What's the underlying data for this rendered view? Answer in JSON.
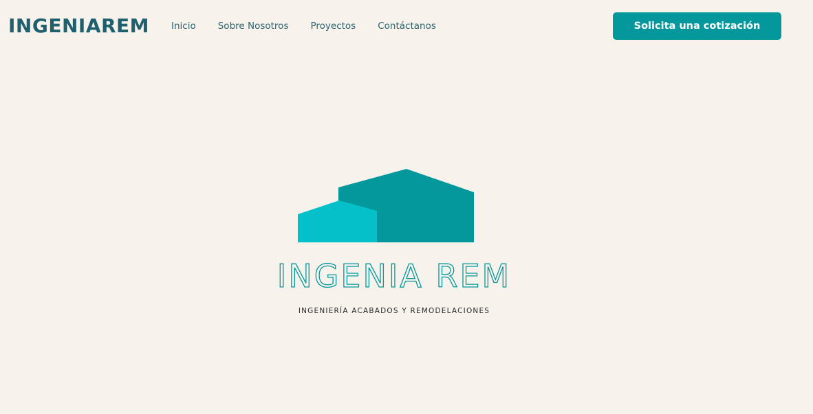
{
  "header": {
    "brand": "INGENIAREM",
    "nav": [
      "Inicio",
      "Sobre Nosotros",
      "Proyectos",
      "Contáctanos"
    ],
    "cta_label": "Solicita una cotización"
  },
  "hero": {
    "logo_title": "INGENIA REM",
    "tagline": "INGENIERÍA ACABADOS Y REMODELACIONES"
  },
  "colors": {
    "background": "#f7f3ec",
    "brand_text": "#1f5f6e",
    "accent": "#04979c",
    "logo_light": "#04c0c8",
    "logo_dark": "#04979c"
  }
}
